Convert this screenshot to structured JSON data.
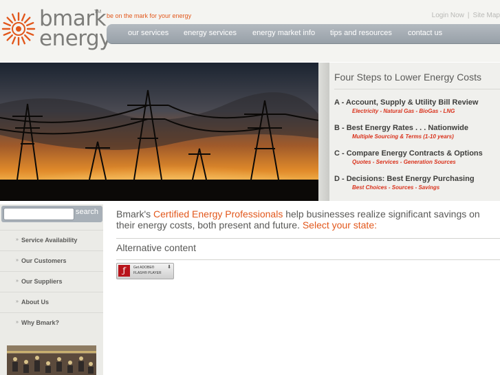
{
  "brand": {
    "logo_line1": "bmark",
    "logo_line2": "energy",
    "tm": "TM",
    "tagline": "be on the mark for your energy",
    "colors": {
      "accent": "#e2571b",
      "red": "#d9321c",
      "nav": "#a2aab1"
    }
  },
  "top_links": {
    "login": "Login Now",
    "separator": "|",
    "sitemap": "Site Map"
  },
  "nav": {
    "items": [
      {
        "label": "our services"
      },
      {
        "label": "energy services"
      },
      {
        "label": "energy market info"
      },
      {
        "label": "tips and resources"
      },
      {
        "label": "contact us"
      }
    ]
  },
  "hero": {
    "image": "power-transmission-towers-at-sunset"
  },
  "steps": {
    "title": "Four Steps to Lower Energy Costs",
    "items": [
      {
        "title": "A - Account, Supply & Utility Bill Review",
        "sub": "Electricity - Natural Gas - BioGas - LNG"
      },
      {
        "title": "B - Best Energy Rates . . . Nationwide",
        "sub": "Multiple Sourcing & Terms (1-10 years)"
      },
      {
        "title": "C - Compare Energy Contracts & Options",
        "sub": "Quotes - Services - Generation Sources"
      },
      {
        "title": "D - Decisions: Best Energy Purchasing",
        "sub": "Best Choices - Sources - Savings"
      }
    ]
  },
  "search": {
    "placeholder": "",
    "button": "search"
  },
  "sidebar": {
    "items": [
      {
        "label": "Service Availability"
      },
      {
        "label": "Our Customers"
      },
      {
        "label": "Our Suppliers"
      },
      {
        "label": "About Us"
      },
      {
        "label": "Why Bmark?"
      }
    ],
    "bullet": "»"
  },
  "main": {
    "intro_part1": "Bmark's ",
    "intro_accent1": "Certified Energy Professionals",
    "intro_part2": " help businesses realize significant savings on their energy costs, both present and future. ",
    "intro_accent2": "Select your state:",
    "alt_title": "Alternative content"
  },
  "flash": {
    "line1": "Get ADOBE®",
    "line2": "FLASH® PLAYER",
    "icon": "flash-icon",
    "download": "download-arrow-icon"
  }
}
